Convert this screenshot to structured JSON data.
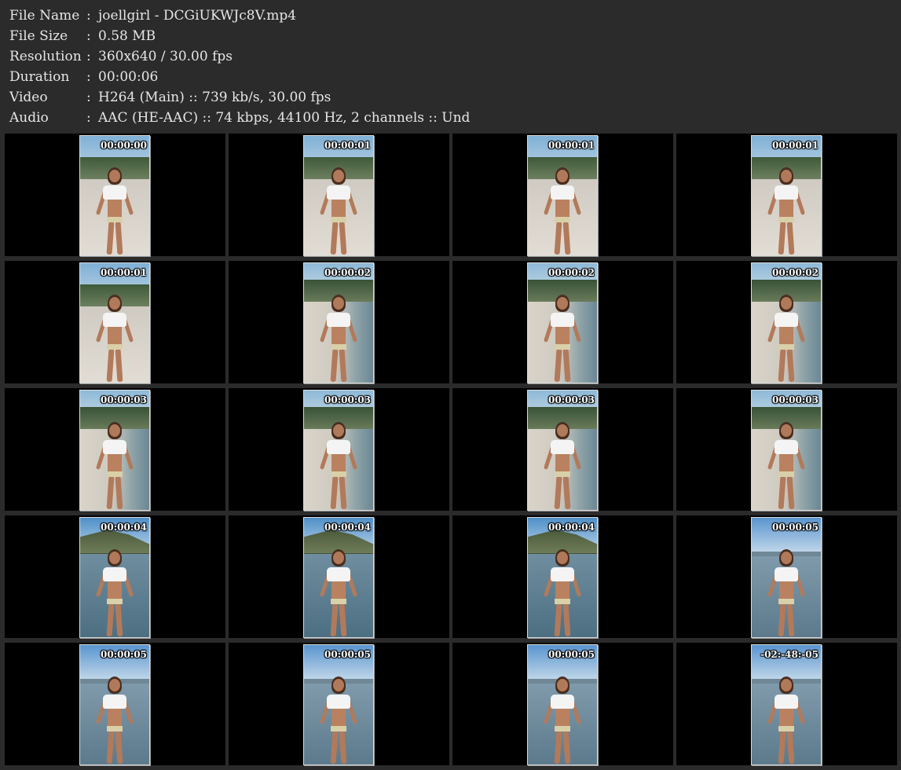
{
  "info": [
    {
      "key": "File Name",
      "value": "joellgirl - DCGiUKWJc8V.mp4"
    },
    {
      "key": "File Size",
      "value": "0.58 MB"
    },
    {
      "key": "Resolution",
      "value": "360x640 / 30.00 fps"
    },
    {
      "key": "Duration",
      "value": "00:00:06"
    },
    {
      "key": "Video",
      "value": "H264 (Main) :: 739 kb/s, 30.00 fps"
    },
    {
      "key": "Audio",
      "value": "AAC (HE-AAC) :: 74 kbps, 44100 Hz, 2 channels :: Und"
    }
  ],
  "separator": ":",
  "thumbnails": [
    {
      "timestamp": "00:00:00",
      "scene": "beach"
    },
    {
      "timestamp": "00:00:01",
      "scene": "beach"
    },
    {
      "timestamp": "00:00:01",
      "scene": "beach"
    },
    {
      "timestamp": "00:00:01",
      "scene": "beach"
    },
    {
      "timestamp": "00:00:01",
      "scene": "beach"
    },
    {
      "timestamp": "00:00:02",
      "scene": "shore"
    },
    {
      "timestamp": "00:00:02",
      "scene": "shore"
    },
    {
      "timestamp": "00:00:02",
      "scene": "shore"
    },
    {
      "timestamp": "00:00:03",
      "scene": "shore"
    },
    {
      "timestamp": "00:00:03",
      "scene": "shore"
    },
    {
      "timestamp": "00:00:03",
      "scene": "shore"
    },
    {
      "timestamp": "00:00:03",
      "scene": "shore"
    },
    {
      "timestamp": "00:00:04",
      "scene": "sea"
    },
    {
      "timestamp": "00:00:04",
      "scene": "sea"
    },
    {
      "timestamp": "00:00:04",
      "scene": "sea"
    },
    {
      "timestamp": "00:00:05",
      "scene": "open"
    },
    {
      "timestamp": "00:00:05",
      "scene": "open"
    },
    {
      "timestamp": "00:00:05",
      "scene": "open"
    },
    {
      "timestamp": "00:00:05",
      "scene": "open"
    },
    {
      "timestamp": "-02:-48:-05",
      "scene": "open"
    }
  ]
}
